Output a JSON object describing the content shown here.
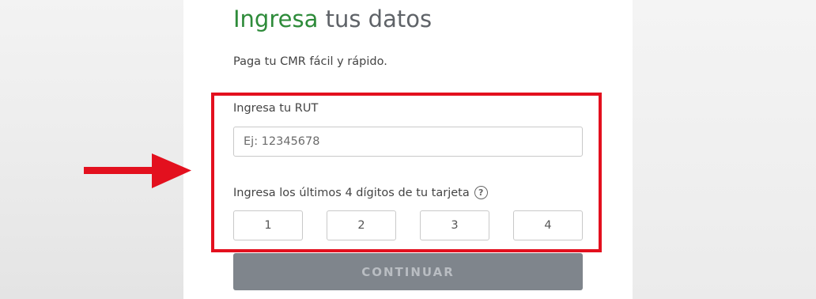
{
  "form": {
    "title_accent": "Ingresa",
    "title_rest": " tus datos",
    "subtitle": "Paga tu CMR fácil y rápido.",
    "rut_label": "Ingresa tu RUT",
    "rut_placeholder": "Ej: 12345678",
    "rut_value": "",
    "digits_label": "Ingresa los últimos 4 dígitos de tu tarjeta",
    "help_glyph": "?",
    "digit_placeholders": [
      "1",
      "2",
      "3",
      "4"
    ],
    "continue_label": "CONTINUAR"
  },
  "icons": {
    "help": "help-circle-icon",
    "annotation": "red-arrow-icon"
  },
  "colors": {
    "accent_green": "#2e8b3a",
    "highlight_red": "#e3101e",
    "button_disabled": "#7f858c",
    "button_text": "#b9bdc2"
  }
}
